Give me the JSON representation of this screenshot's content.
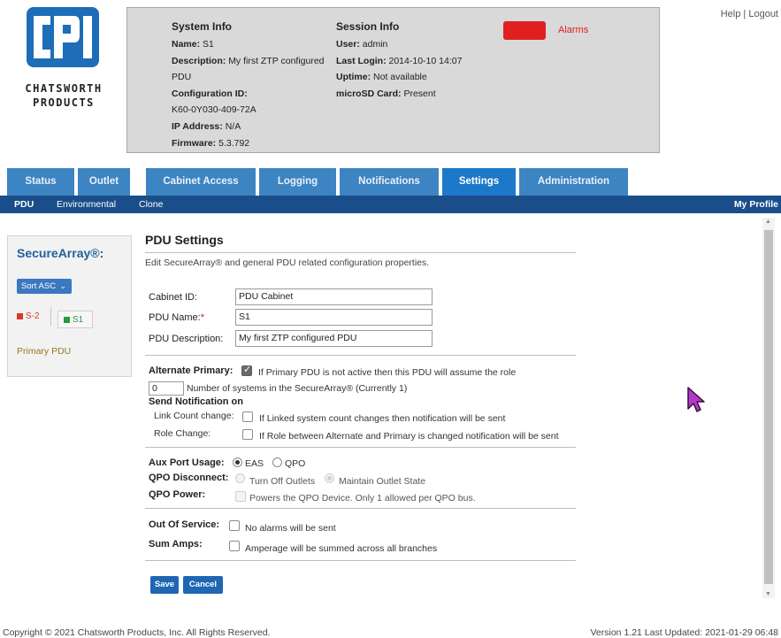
{
  "brand": {
    "line1": "CHATSWORTH",
    "line2": "PRODUCTS"
  },
  "colors": {
    "tab_bg": "#3d84c2",
    "tab_active": "#1c79c9",
    "subnav_bg": "#1a4e8a",
    "alarm": "#e02020",
    "primary_btn": "#1f66b3"
  },
  "top_links": {
    "help": "Help",
    "separator": " | ",
    "logout": "Logout"
  },
  "system_info": {
    "title": "System Info",
    "name_label": "Name:",
    "name": "S1",
    "description_label": "Description:",
    "description": "My first ZTP configured",
    "description_cont": "PDU",
    "config_id_label": "Configuration ID:",
    "config_id": "K60-0Y030-409-72A",
    "ip_label": "IP Address:",
    "ip": "N/A",
    "firmware_label": "Firmware:",
    "firmware": "5.3.792"
  },
  "session_info": {
    "title": "Session Info",
    "user_label": "User:",
    "user": "admin",
    "last_login_label": "Last Login:",
    "last_login": "2014-10-10 14:07",
    "uptime_label": "Uptime:",
    "uptime": "Not available",
    "microsd_label": "microSD Card:",
    "microsd": "Present"
  },
  "alarms": {
    "label": "Alarms"
  },
  "tabs": [
    "Status",
    "Outlet",
    "Cabinet Access",
    "Logging",
    "Notifications",
    "Settings",
    "Administration"
  ],
  "active_tab": "Settings",
  "subnav": {
    "pdu": "PDU",
    "environmental": "Environmental",
    "clone": "Clone",
    "my_profile": "My Profile"
  },
  "left_panel": {
    "title": "SecureArray®:",
    "sort_button": "Sort ASC",
    "nodes": [
      {
        "label": "S-2",
        "color": "#d83a2a"
      },
      {
        "label": "S1",
        "color": "#2a9a3a"
      }
    ],
    "primary_label": "Primary PDU"
  },
  "settings": {
    "title": "PDU Settings",
    "description": "Edit SecureArray® and general PDU related configuration properties.",
    "cabinet_id_label": "Cabinet ID:",
    "cabinet_id": "PDU Cabinet",
    "pdu_name_label": "PDU Name:",
    "required_mark": "*",
    "pdu_name": "S1",
    "pdu_desc_label": "PDU Description:",
    "pdu_desc": "My first ZTP configured PDU",
    "alt_primary_label": "Alternate Primary:",
    "alt_primary_text": "If Primary PDU is not active then this PDU will assume the role",
    "alt_primary_checked": true,
    "systems_count": "0",
    "systems_text": "Number of systems in the SecureArray® (Currently 1)",
    "send_notification_label": "Send Notification on",
    "link_count_label": "Link Count change:",
    "link_count_text": "If Linked system count changes then notification will be sent",
    "role_change_label": "Role Change:",
    "role_change_text": "If Role between Alternate and Primary is changed notification will be sent",
    "aux_port_label": "Aux Port Usage:",
    "aux_eas": "EAS",
    "aux_qpo": "QPO",
    "aux_selected": "EAS",
    "qpo_disconnect_label": "QPO Disconnect:",
    "qpo_turn_off": "Turn Off Outlets",
    "qpo_maintain": "Maintain Outlet State",
    "qpo_power_label": "QPO Power:",
    "qpo_power_text": "Powers the QPO Device. Only 1 allowed per QPO bus.",
    "out_of_service_label": "Out Of Service:",
    "out_of_service_text": "No alarms will be sent",
    "sum_amps_label": "Sum Amps:",
    "sum_amps_text": "Amperage will be summed across all branches",
    "save_label": "Save",
    "cancel_label": "Cancel"
  },
  "footer": {
    "copyright": "Copyright © 2021 Chatsworth Products, Inc. All Rights Reserved.",
    "version": "Version 1.21 Last Updated: 2021-01-29 06:48"
  }
}
